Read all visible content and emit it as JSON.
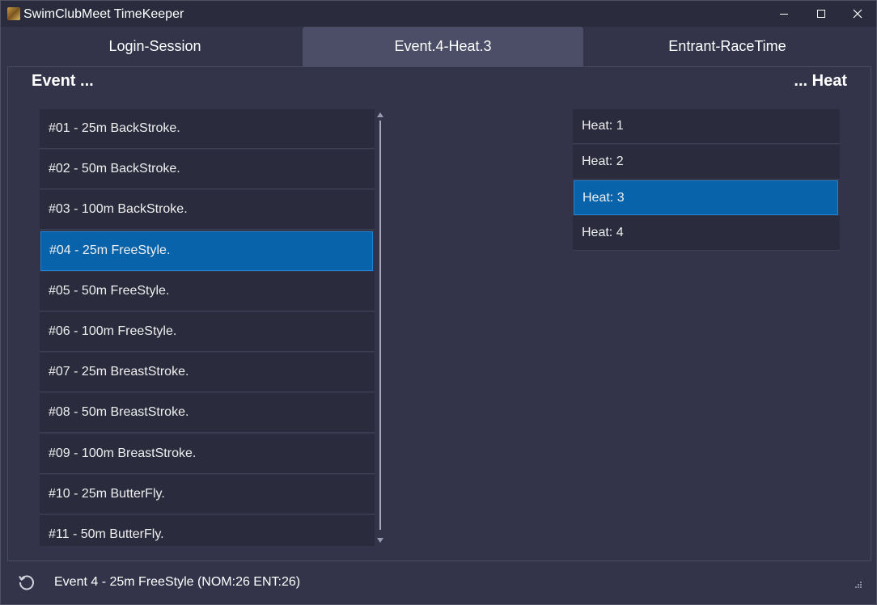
{
  "window": {
    "title": "SwimClubMeet TimeKeeper",
    "controls": [
      "minimize-icon",
      "maximize-icon",
      "close-icon"
    ]
  },
  "tabs": [
    {
      "label": "Login-Session",
      "active": false
    },
    {
      "label": "Event.4-Heat.3",
      "active": true
    },
    {
      "label": "Entrant-RaceTime",
      "active": false
    }
  ],
  "panel": {
    "left_header": "Event ...",
    "right_header": "... Heat"
  },
  "events": [
    {
      "label": "#01 - 25m BackStroke.",
      "selected": false
    },
    {
      "label": "#02 - 50m BackStroke.",
      "selected": false
    },
    {
      "label": "#03 - 100m BackStroke.",
      "selected": false
    },
    {
      "label": "#04 - 25m FreeStyle.",
      "selected": true
    },
    {
      "label": "#05 - 50m FreeStyle.",
      "selected": false
    },
    {
      "label": "#06 - 100m FreeStyle.",
      "selected": false
    },
    {
      "label": "#07 - 25m BreastStroke.",
      "selected": false
    },
    {
      "label": "#08 - 50m BreastStroke.",
      "selected": false
    },
    {
      "label": "#09 - 100m BreastStroke.",
      "selected": false
    },
    {
      "label": "#10 - 25m ButterFly.",
      "selected": false
    },
    {
      "label": "#11 - 50m ButterFly.",
      "selected": false
    }
  ],
  "heats": [
    {
      "label": "Heat: 1",
      "selected": false
    },
    {
      "label": "Heat: 2",
      "selected": false
    },
    {
      "label": "Heat: 3",
      "selected": true
    },
    {
      "label": "Heat: 4",
      "selected": false
    }
  ],
  "status": {
    "text": "Event 4 - 25m FreeStyle (NOM:26 ENT:26)",
    "icon": "refresh-icon"
  },
  "colors": {
    "background": "#33344a",
    "titlebar": "#2a2b3d",
    "list_item": "#2a2b3c",
    "selection": "#0863aa",
    "active_tab": "#4b4e66"
  }
}
